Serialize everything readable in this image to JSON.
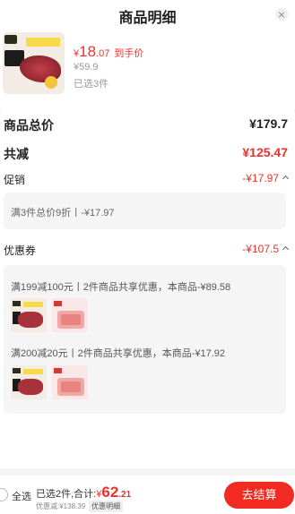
{
  "header": {
    "title": "商品明细"
  },
  "product": {
    "currency": "¥",
    "price_int": "18",
    "price_dec": ".07",
    "price_tag": "到手价",
    "original_price": "¥59.9",
    "selected_count": "已选3件"
  },
  "summary": {
    "total_label": "商品总价",
    "total_value": "¥179.7",
    "discount_label": "共减",
    "discount_value": "¥125.47",
    "promo_label": "促销",
    "promo_value": "-¥17.97",
    "promo_detail": "满3件总价9折丨-¥17.97",
    "coupon_label": "优惠券",
    "coupon_value": "-¥107.5",
    "coupons": [
      {
        "text": "满199减100元丨2件商品共享优惠，本商品-¥89.58"
      },
      {
        "text": "满200减20元丨2件商品共享优惠，本商品-¥17.92"
      }
    ]
  },
  "footer": {
    "select_all": "全选",
    "summary_prefix": "已选2件,合计:",
    "currency": "¥",
    "amount_int": "62",
    "amount_dec": ".21",
    "discount_note": "优惠减:¥138.39",
    "detail_button": "优惠明细",
    "checkout_button": "去结算"
  },
  "colors": {
    "accent": "#f0302a",
    "button": "#f22b22"
  },
  "icons": [
    "close-icon",
    "chevron-up-icon",
    "radio-icon"
  ]
}
